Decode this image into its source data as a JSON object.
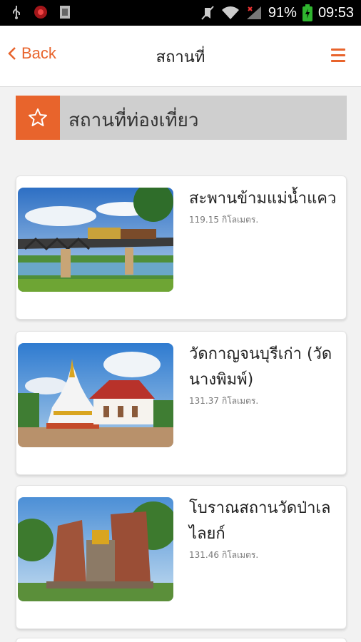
{
  "status_bar": {
    "battery": "91%",
    "time": "09:53"
  },
  "header": {
    "back_label": "Back",
    "title": "สถานที่"
  },
  "section": {
    "label": "สถานที่ท่องเที่ยว"
  },
  "places": [
    {
      "name": "สะพานข้ามแม่น้ำแคว",
      "distance": "119.15",
      "unit": "กิโลเมตร."
    },
    {
      "name": "วัดกาญจนบุรีเก่า (วัดนางพิมพ์)",
      "distance": "131.37",
      "unit": "กิโลเมตร."
    },
    {
      "name": "โบราณสถานวัดป่าเลไลยก์",
      "distance": "131.46",
      "unit": "กิโลเมตร."
    }
  ],
  "colors": {
    "accent": "#e8642c",
    "section_bg": "#cfcfcf"
  }
}
